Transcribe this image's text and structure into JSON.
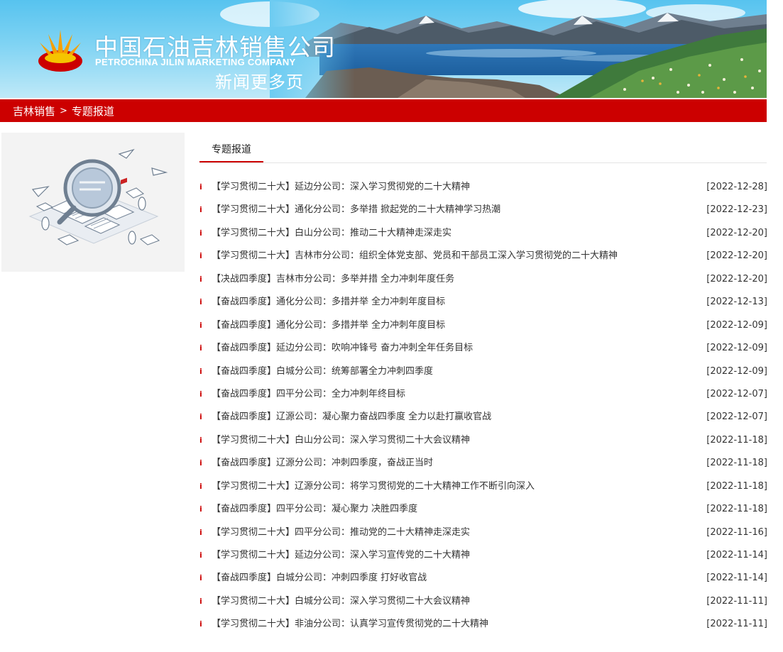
{
  "header": {
    "company_cn": "中国石油吉林销售公司",
    "company_en": "PETROCHINA JILIN MARKETING COMPANY",
    "subtitle": "新闻更多页",
    "logo_icon": "petrochina-logo-icon",
    "colors": {
      "brand_red": "#cc0000",
      "sky_blue": "#57c3ef"
    }
  },
  "breadcrumb": {
    "home": "吉林销售",
    "separator": ">",
    "current": "专题报道"
  },
  "section": {
    "tab_label": "专题报道"
  },
  "news": {
    "bullet": "i",
    "items": [
      {
        "title": "【学习贯彻二十大】延边分公司：深入学习贯彻党的二十大精神",
        "date": "[2022-12-28]"
      },
      {
        "title": "【学习贯彻二十大】通化分公司：多举措 掀起党的二十大精神学习热潮",
        "date": "[2022-12-23]"
      },
      {
        "title": "【学习贯彻二十大】白山分公司：推动二十大精神走深走实",
        "date": "[2022-12-20]"
      },
      {
        "title": "【学习贯彻二十大】吉林市分公司：组织全体党支部、党员和干部员工深入学习贯彻党的二十大精神",
        "date": "[2022-12-20]"
      },
      {
        "title": "【决战四季度】吉林市分公司：多举并措 全力冲刺年度任务",
        "date": "[2022-12-20]"
      },
      {
        "title": "【奋战四季度】通化分公司：多措并举 全力冲刺年度目标",
        "date": "[2022-12-13]"
      },
      {
        "title": "【奋战四季度】通化分公司：多措并举 全力冲刺年度目标",
        "date": "[2022-12-09]"
      },
      {
        "title": "【奋战四季度】延边分公司：吹响冲锋号 奋力冲刺全年任务目标",
        "date": "[2022-12-09]"
      },
      {
        "title": "【奋战四季度】白城分公司：统筹部署全力冲刺四季度",
        "date": "[2022-12-09]"
      },
      {
        "title": "【奋战四季度】四平分公司：全力冲刺年终目标",
        "date": "[2022-12-07]"
      },
      {
        "title": "【奋战四季度】辽源公司：凝心聚力奋战四季度 全力以赴打赢收官战",
        "date": "[2022-12-07]"
      },
      {
        "title": "【学习贯彻二十大】白山分公司：深入学习贯彻二十大会议精神",
        "date": "[2022-11-18]"
      },
      {
        "title": "【奋战四季度】辽源分公司：冲刺四季度，奋战正当时",
        "date": "[2022-11-18]"
      },
      {
        "title": "【学习贯彻二十大】辽源分公司：将学习贯彻党的二十大精神工作不断引向深入",
        "date": "[2022-11-18]"
      },
      {
        "title": "【奋战四季度】四平分公司：凝心聚力 决胜四季度",
        "date": "[2022-11-18]"
      },
      {
        "title": "【学习贯彻二十大】四平分公司：推动党的二十大精神走深走实",
        "date": "[2022-11-16]"
      },
      {
        "title": "【学习贯彻二十大】延边分公司：深入学习宣传党的二十大精神",
        "date": "[2022-11-14]"
      },
      {
        "title": "【奋战四季度】白城分公司：冲刺四季度 打好收官战",
        "date": "[2022-11-14]"
      },
      {
        "title": "【学习贯彻二十大】白城分公司：深入学习贯彻二十大会议精神",
        "date": "[2022-11-11]"
      },
      {
        "title": "【学习贯彻二十大】非油分公司：认真学习宣传贯彻党的二十大精神",
        "date": "[2022-11-11]"
      }
    ]
  },
  "illustration": {
    "icon": "magnifier-documents-illustration"
  }
}
